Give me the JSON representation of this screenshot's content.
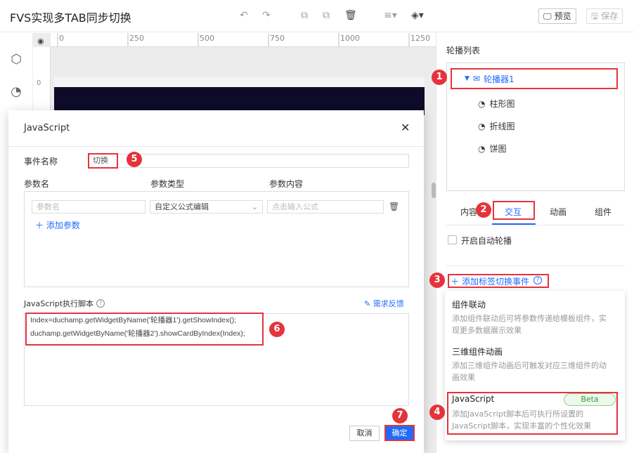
{
  "app": {
    "title": "FVS实现多TAB同步切换"
  },
  "toolbar": {
    "preview_label": "预览",
    "save_label": "保存"
  },
  "ruler": {
    "ticks": [
      "0",
      "250",
      "500",
      "750",
      "1000",
      "1250"
    ],
    "v_label": "0"
  },
  "right_panel": {
    "title": "轮播列表",
    "tree_root": "轮播器1",
    "tree_children": [
      "柱形图",
      "折线图",
      "饼图"
    ],
    "tabs": [
      "内容",
      "交互",
      "动画",
      "组件"
    ],
    "autoplay_label": "开启自动轮播",
    "add_event_label": "添加标签切换事件",
    "dropdown": [
      {
        "title": "组件联动",
        "desc": "添加组件联动后可将参数传递给模板组件，实现更多数据展示效果"
      },
      {
        "title": "三维组件动画",
        "desc": "添加三维组件动画后可触发对应三维组件的动画效果"
      },
      {
        "title": "JavaScript",
        "badge": "Beta",
        "desc": "添加JavaScript脚本后可执行所设置的JavaScript脚本，实现丰富的个性化效果"
      }
    ]
  },
  "dialog": {
    "title": "JavaScript",
    "event_name_label": "事件名称",
    "event_name_value": "切换",
    "param_headers": [
      "参数名",
      "参数类型",
      "参数内容"
    ],
    "param_name_placeholder": "参数名",
    "param_type_value": "自定义公式编辑",
    "param_content_placeholder": "点击输入公式",
    "add_param_label": "添加参数",
    "script_label": "JavaScript执行脚本",
    "feedback_label": "需求反馈",
    "script_lines": [
      "Index=duchamp.getWidgetByName('轮播器1').getShowIndex();",
      "duchamp.getWidgetByName('轮播器2').showCardByIndex(Index);"
    ],
    "cancel_label": "取消",
    "ok_label": "确定"
  },
  "markers": [
    "1",
    "2",
    "3",
    "4",
    "5",
    "6",
    "7"
  ],
  "colors": {
    "accent": "#1f6bff",
    "highlight": "#e5333b",
    "beta": "#3a9a3a"
  }
}
